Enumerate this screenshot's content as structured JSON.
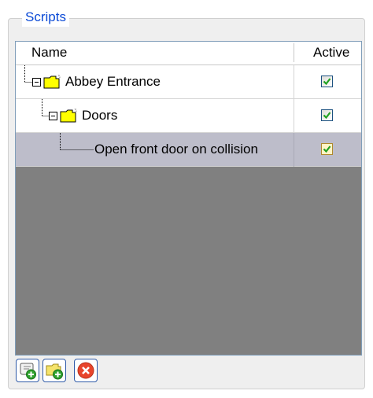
{
  "group": {
    "title": "Scripts"
  },
  "columns": {
    "name": "Name",
    "active": "Active"
  },
  "rows": [
    {
      "label": "Abbey Entrance",
      "level": 0,
      "type": "folder",
      "active": true,
      "selected": false
    },
    {
      "label": "Doors",
      "level": 1,
      "type": "folder",
      "active": true,
      "selected": false
    },
    {
      "label": "Open front door on collision",
      "level": 2,
      "type": "script",
      "active": true,
      "selected": true
    }
  ],
  "toolbar": {
    "buttons": [
      {
        "icon": "add-script-icon"
      },
      {
        "icon": "add-folder-icon"
      },
      {
        "icon": "delete-icon"
      }
    ]
  },
  "colors": {
    "group_title": "#0b4ad6",
    "tree_background": "#808080",
    "selected_row": "#bdbdca",
    "check": "#21a121",
    "folder": "#ffff00"
  }
}
